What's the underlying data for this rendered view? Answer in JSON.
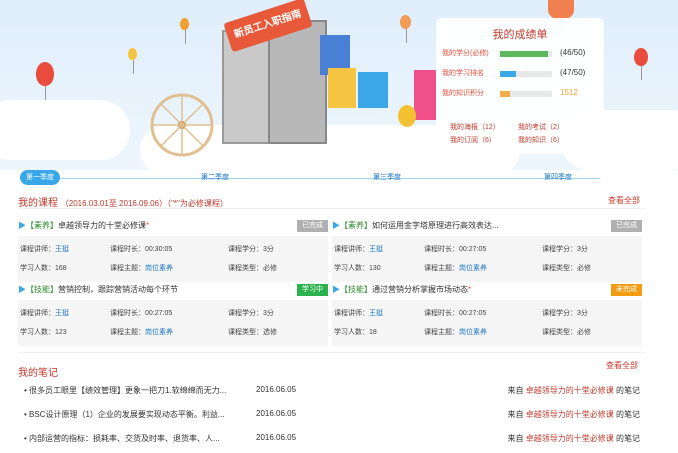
{
  "banner": {
    "sign_text": "新员工入职指南",
    "score": {
      "title": "我的成绩单",
      "rows": [
        {
          "label": "我的学分(必修)",
          "value": "(46/50)",
          "progress": 0.92,
          "color": "#5cb85c"
        },
        {
          "label": "我的学习排名",
          "value": "(47/50)",
          "progress": 0.3,
          "color": "#3aa8e8"
        },
        {
          "label": "我的知识积分",
          "value": "1512",
          "progress": 0.2,
          "color": "#f0ad4e"
        }
      ],
      "links": [
        "我的海报（12）",
        "我的考试（2）",
        "我的订阅（6）",
        "我的知识（6）"
      ]
    }
  },
  "timeline": [
    "第一季度",
    "第二季度",
    "第三季度",
    "第四季度"
  ],
  "courses": {
    "heading": "我的课程",
    "range": "（2016.03.01至 2016.09.06）（\"*\"为必修课程）",
    "more": "查看全部",
    "items": [
      {
        "arrow": "▶",
        "tag": "【素养】",
        "title": "卓越领导力的十堂必修课",
        "star": "*",
        "status": "已完成",
        "status_color": "#b0b0b0",
        "teacher_label": "课程讲师：",
        "teacher": "王挺",
        "duration": "课程时长：00:30:05",
        "credit": "课程学分：3分",
        "learners": "学习人数：168",
        "topic_label": "课程主题：",
        "topic": "岗位素养",
        "type": "课程类型：必修"
      },
      {
        "arrow": "▶",
        "tag": "【素养】",
        "title": "如何运用金字塔原理进行高效表达...",
        "star": "",
        "status": "已完成",
        "status_color": "#b0b0b0",
        "teacher_label": "课程讲师：",
        "teacher": "王挺",
        "duration": "课程时长：00:27:05",
        "credit": "课程学分：3分",
        "learners": "学习人数：130",
        "topic_label": "课程主题：",
        "topic": "岗位素养",
        "type": "课程类型：必修"
      },
      {
        "arrow": "▶",
        "tag": "【技能】",
        "title": "营销控制，跟踪营销活动每个环节",
        "star": "",
        "status": "学习中",
        "status_color": "#2bb24c",
        "teacher_label": "课程讲师：",
        "teacher": "王挺",
        "duration": "课程时长：00:27:05",
        "credit": "课程学分：3分",
        "learners": "学习人数：123",
        "topic_label": "课程主题：",
        "topic": "岗位素养",
        "type": "课程类型：选修"
      },
      {
        "arrow": "▶",
        "tag": "【技能】",
        "title": "通过营销分析掌握市场动态",
        "star": "*",
        "status": "未完成",
        "status_color": "#f39c12",
        "teacher_label": "课程讲师：",
        "teacher": "王挺",
        "duration": "课程时长：00:27:05",
        "credit": "课程学分：3分",
        "learners": "学习人数：18",
        "topic_label": "课程主题：",
        "topic": "岗位素养",
        "type": "课程类型：必修"
      }
    ]
  },
  "notes": {
    "heading": "我的笔记",
    "more": "查看全部",
    "items": [
      {
        "title": "很多员工眼里【绩效管理】更象一把刀1.软绵绵而无力...",
        "date": "2016.06.05",
        "from": "来自",
        "course": "卓越领导力的十堂必修课",
        "suffix": "的笔记"
      },
      {
        "title": "BSC设计原理（1）企业的发展要实现动态平衡。利益...",
        "date": "2016.06.05",
        "from": "来自",
        "course": "卓越领导力的十堂必修课",
        "suffix": "的笔记"
      },
      {
        "title": "内部运营的指标：损耗率、交货及时率、退货率、人...",
        "date": "2016.06.05",
        "from": "来自",
        "course": "卓越领导力的十堂必修课",
        "suffix": "的笔记"
      }
    ]
  }
}
